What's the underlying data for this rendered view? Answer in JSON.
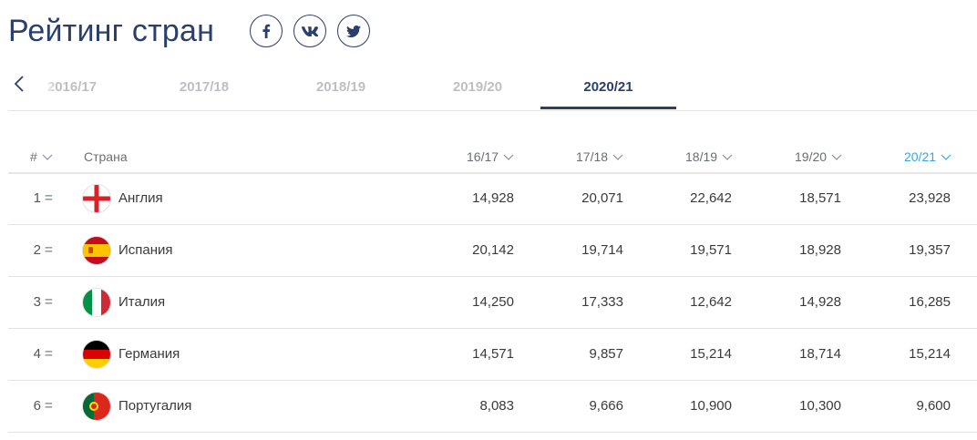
{
  "page": {
    "title": "Рейтинг стран",
    "social": [
      {
        "name": "facebook-icon",
        "glyph": "f"
      },
      {
        "name": "vk-icon",
        "glyph": "vk"
      },
      {
        "name": "twitter-icon",
        "glyph": "tw"
      }
    ]
  },
  "tabs": {
    "items": [
      "2016/17",
      "2017/18",
      "2018/19",
      "2019/20",
      "2020/21"
    ],
    "active": "2020/21"
  },
  "table": {
    "headers": {
      "rank": "#",
      "country": "Страна",
      "c1": "16/17",
      "c2": "17/18",
      "c3": "18/19",
      "c4": "19/20",
      "c5": "20/21"
    },
    "active_column": "20/21",
    "rows": [
      {
        "rank": "1",
        "move": "=",
        "country": "Англия",
        "flag": "england",
        "v": [
          "14,928",
          "20,071",
          "22,642",
          "18,571",
          "23,928"
        ]
      },
      {
        "rank": "2",
        "move": "=",
        "country": "Испания",
        "flag": "spain",
        "v": [
          "20,142",
          "19,714",
          "19,571",
          "18,928",
          "19,357"
        ]
      },
      {
        "rank": "3",
        "move": "=",
        "country": "Италия",
        "flag": "italy",
        "v": [
          "14,250",
          "17,333",
          "12,642",
          "14,928",
          "16,285"
        ]
      },
      {
        "rank": "4",
        "move": "=",
        "country": "Германия",
        "flag": "germany",
        "v": [
          "14,571",
          "9,857",
          "15,214",
          "18,714",
          "15,214"
        ]
      },
      {
        "rank": "6",
        "move": "=",
        "country": "Португалия",
        "flag": "portugal",
        "v": [
          "8,083",
          "9,666",
          "10,900",
          "10,300",
          "9,600"
        ]
      }
    ]
  },
  "colors": {
    "brand": "#2a3f6b",
    "active_column": "#3aa5dd",
    "muted_tab": "#bdbfc4"
  }
}
